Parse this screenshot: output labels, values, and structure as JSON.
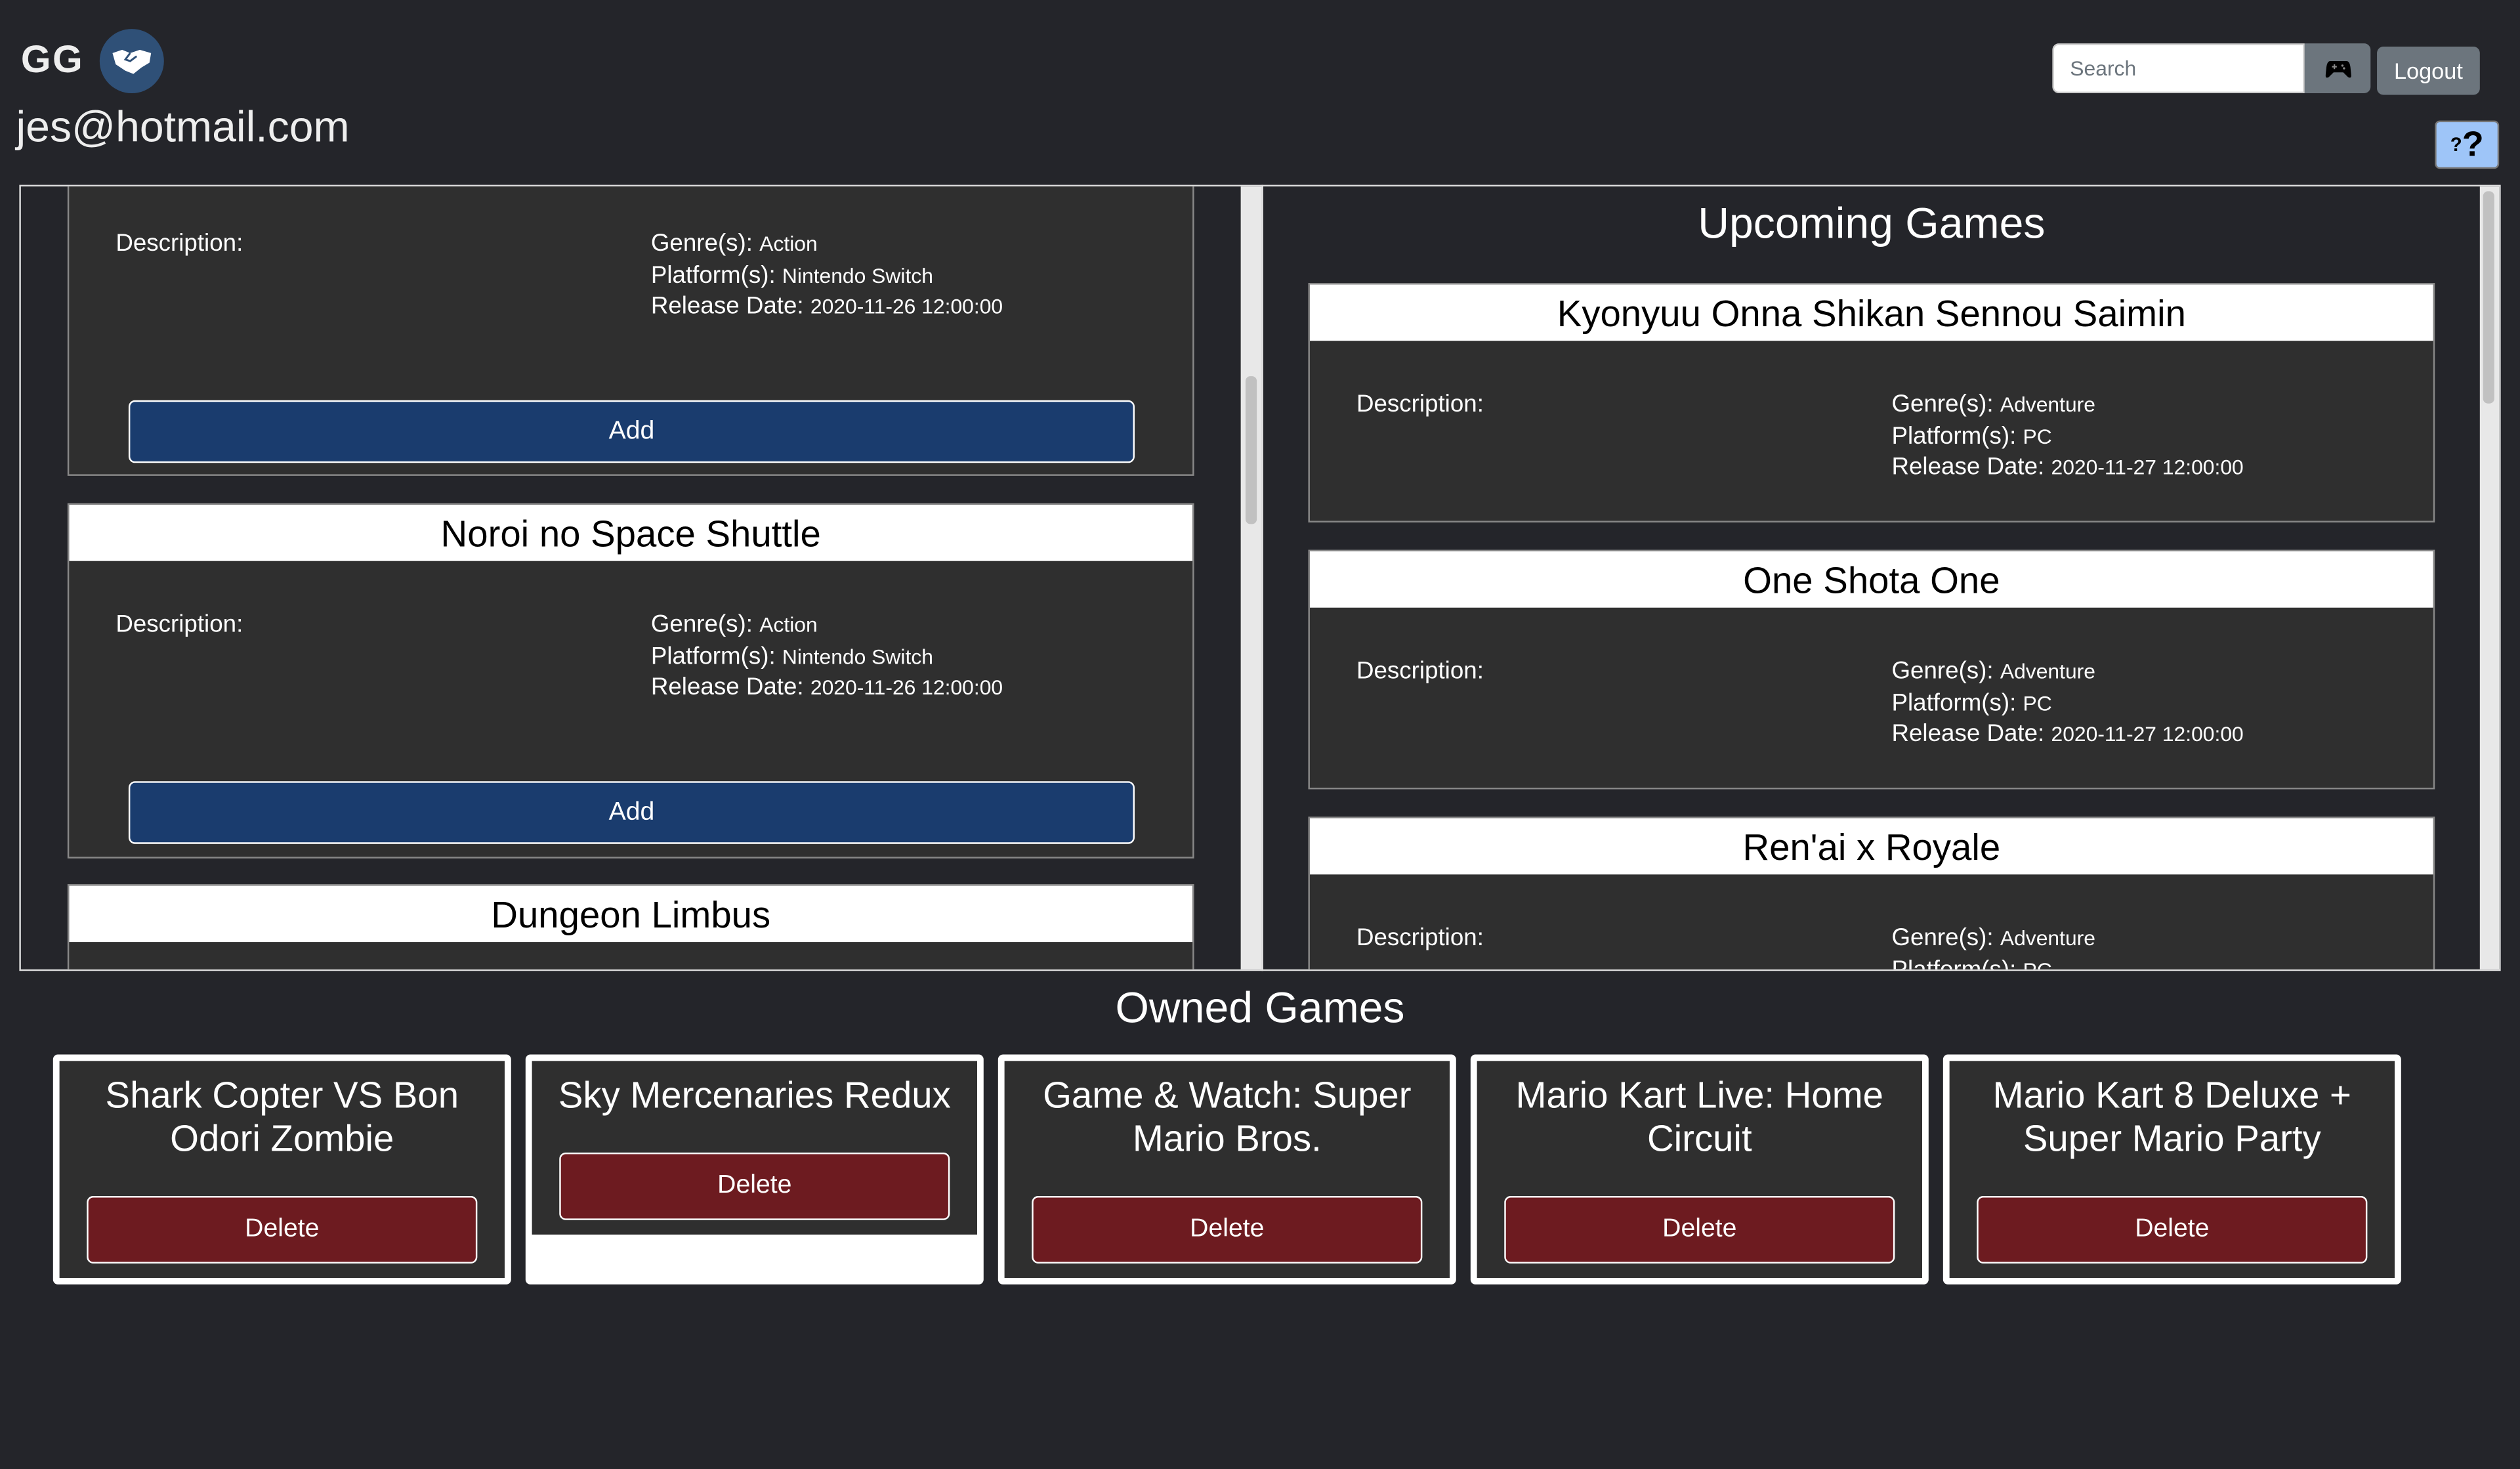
{
  "header": {
    "logo_text": "GG",
    "logo_icon": "handshake-icon",
    "user_email": "jes@hotmail.com",
    "search_placeholder": "Search",
    "search_button_icon": "gamepad-icon",
    "logout_label": "Logout",
    "help_icon": "question-icon"
  },
  "labels": {
    "description": "Description:",
    "genres": "Genre(s):",
    "platforms": "Platform(s):",
    "release_date": "Release Date:",
    "add": "Add",
    "delete": "Delete"
  },
  "search_results": [
    {
      "title": "",
      "genre": "Action",
      "platform": "Nintendo Switch",
      "release": "2020-11-26 12:00:00"
    },
    {
      "title": "Noroi no Space Shuttle",
      "genre": "Action",
      "platform": "Nintendo Switch",
      "release": "2020-11-26 12:00:00"
    },
    {
      "title": "Dungeon Limbus"
    }
  ],
  "upcoming": {
    "title": "Upcoming Games",
    "games": [
      {
        "title": "Kyonyuu Onna Shikan Sennou Saimin",
        "genre": "Adventure",
        "platform": "PC",
        "release": "2020-11-27 12:00:00"
      },
      {
        "title": "One Shota One",
        "genre": "Adventure",
        "platform": "PC",
        "release": "2020-11-27 12:00:00"
      },
      {
        "title": "Ren'ai x Royale",
        "genre": "Adventure",
        "platform": "PC"
      }
    ]
  },
  "owned": {
    "title": "Owned Games",
    "games": [
      {
        "title": "Shark Copter VS Bon Odori Zombie"
      },
      {
        "title": "Sky Mercenaries Redux"
      },
      {
        "title": "Game & Watch: Super Mario Bros."
      },
      {
        "title": "Mario Kart Live: Home Circuit"
      },
      {
        "title": "Mario Kart 8 Deluxe + Super Mario Party"
      }
    ]
  },
  "colors": {
    "background": "#24252a",
    "card": "#2f2f2f",
    "add_button": "#1a3c6e",
    "delete_button": "#6d1b20",
    "help_button": "#9ec5f8",
    "logo_circle": "#2f5077"
  }
}
